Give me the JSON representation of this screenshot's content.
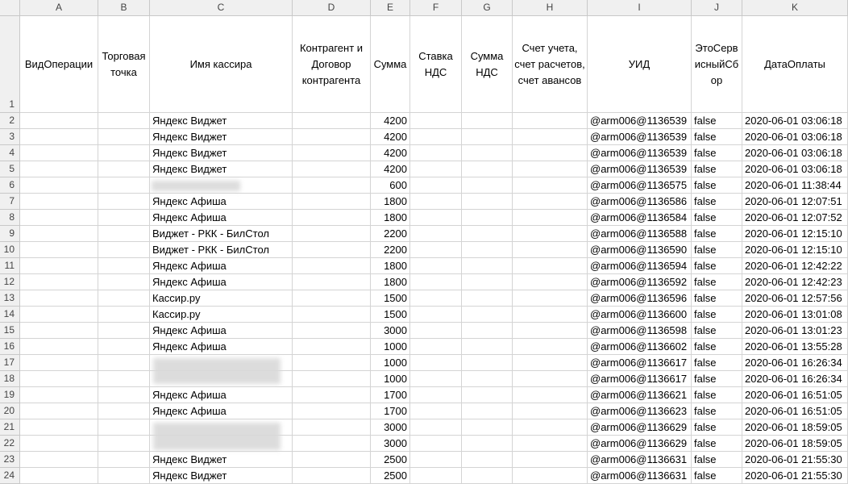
{
  "columns": [
    "A",
    "B",
    "C",
    "D",
    "E",
    "F",
    "G",
    "H",
    "I",
    "J",
    "K"
  ],
  "headers": {
    "A": "ВидОперации",
    "B": "Торговая точка",
    "C": "Имя кассира",
    "D": "Контрагент и Договор контрагента",
    "E": "Сумма",
    "F": "Ставка НДС",
    "G": "Сумма НДС",
    "H": "Счет учета, счет расчетов, счет авансов",
    "I": "УИД",
    "J": "ЭтоСервисныйСбор",
    "K": "ДатаОплаты"
  },
  "rows": [
    {
      "n": "2",
      "cashier": "Яндекс Виджет",
      "sum": "4200",
      "uid": "@arm006@1136539",
      "flag": "false",
      "date": "2020-06-01 03:06:18"
    },
    {
      "n": "3",
      "cashier": "Яндекс Виджет",
      "sum": "4200",
      "uid": "@arm006@1136539",
      "flag": "false",
      "date": "2020-06-01 03:06:18"
    },
    {
      "n": "4",
      "cashier": "Яндекс Виджет",
      "sum": "4200",
      "uid": "@arm006@1136539",
      "flag": "false",
      "date": "2020-06-01 03:06:18"
    },
    {
      "n": "5",
      "cashier": "Яндекс Виджет",
      "sum": "4200",
      "uid": "@arm006@1136539",
      "flag": "false",
      "date": "2020-06-01 03:06:18"
    },
    {
      "n": "6",
      "cashier": "",
      "sum": "600",
      "uid": "@arm006@1136575",
      "flag": "false",
      "date": "2020-06-01 11:38:44"
    },
    {
      "n": "7",
      "cashier": "Яндекс Афиша",
      "sum": "1800",
      "uid": "@arm006@1136586",
      "flag": "false",
      "date": "2020-06-01 12:07:51"
    },
    {
      "n": "8",
      "cashier": "Яндекс Афиша",
      "sum": "1800",
      "uid": "@arm006@1136584",
      "flag": "false",
      "date": "2020-06-01 12:07:52"
    },
    {
      "n": "9",
      "cashier": "Виджет - РКК - БилСтол",
      "sum": "2200",
      "uid": "@arm006@1136588",
      "flag": "false",
      "date": "2020-06-01 12:15:10"
    },
    {
      "n": "10",
      "cashier": "Виджет - РКК - БилСтол",
      "sum": "2200",
      "uid": "@arm006@1136590",
      "flag": "false",
      "date": "2020-06-01 12:15:10"
    },
    {
      "n": "11",
      "cashier": "Яндекс Афиша",
      "sum": "1800",
      "uid": "@arm006@1136594",
      "flag": "false",
      "date": "2020-06-01 12:42:22"
    },
    {
      "n": "12",
      "cashier": "Яндекс Афиша",
      "sum": "1800",
      "uid": "@arm006@1136592",
      "flag": "false",
      "date": "2020-06-01 12:42:23"
    },
    {
      "n": "13",
      "cashier": "Кассир.ру",
      "sum": "1500",
      "uid": "@arm006@1136596",
      "flag": "false",
      "date": "2020-06-01 12:57:56"
    },
    {
      "n": "14",
      "cashier": "Кассир.ру",
      "sum": "1500",
      "uid": "@arm006@1136600",
      "flag": "false",
      "date": "2020-06-01 13:01:08"
    },
    {
      "n": "15",
      "cashier": "Яндекс Афиша",
      "sum": "3000",
      "uid": "@arm006@1136598",
      "flag": "false",
      "date": "2020-06-01 13:01:23"
    },
    {
      "n": "16",
      "cashier": "Яндекс Афиша",
      "sum": "1000",
      "uid": "@arm006@1136602",
      "flag": "false",
      "date": "2020-06-01 13:55:28"
    },
    {
      "n": "17",
      "cashier": "",
      "sum": "1000",
      "uid": "@arm006@1136617",
      "flag": "false",
      "date": "2020-06-01 16:26:34"
    },
    {
      "n": "18",
      "cashier": "",
      "sum": "1000",
      "uid": "@arm006@1136617",
      "flag": "false",
      "date": "2020-06-01 16:26:34"
    },
    {
      "n": "19",
      "cashier": "Яндекс Афиша",
      "sum": "1700",
      "uid": "@arm006@1136621",
      "flag": "false",
      "date": "2020-06-01 16:51:05"
    },
    {
      "n": "20",
      "cashier": "Яндекс Афиша",
      "sum": "1700",
      "uid": "@arm006@1136623",
      "flag": "false",
      "date": "2020-06-01 16:51:05"
    },
    {
      "n": "21",
      "cashier": "",
      "sum": "3000",
      "uid": "@arm006@1136629",
      "flag": "false",
      "date": "2020-06-01 18:59:05"
    },
    {
      "n": "22",
      "cashier": "",
      "sum": "3000",
      "uid": "@arm006@1136629",
      "flag": "false",
      "date": "2020-06-01 18:59:05"
    },
    {
      "n": "23",
      "cashier": "Яндекс Виджет",
      "sum": "2500",
      "uid": "@arm006@1136631",
      "flag": "false",
      "date": "2020-06-01 21:55:30"
    },
    {
      "n": "24",
      "cashier": "Яндекс Виджет",
      "sum": "2500",
      "uid": "@arm006@1136631",
      "flag": "false",
      "date": "2020-06-01 21:55:30"
    }
  ],
  "header_row_number": "1"
}
